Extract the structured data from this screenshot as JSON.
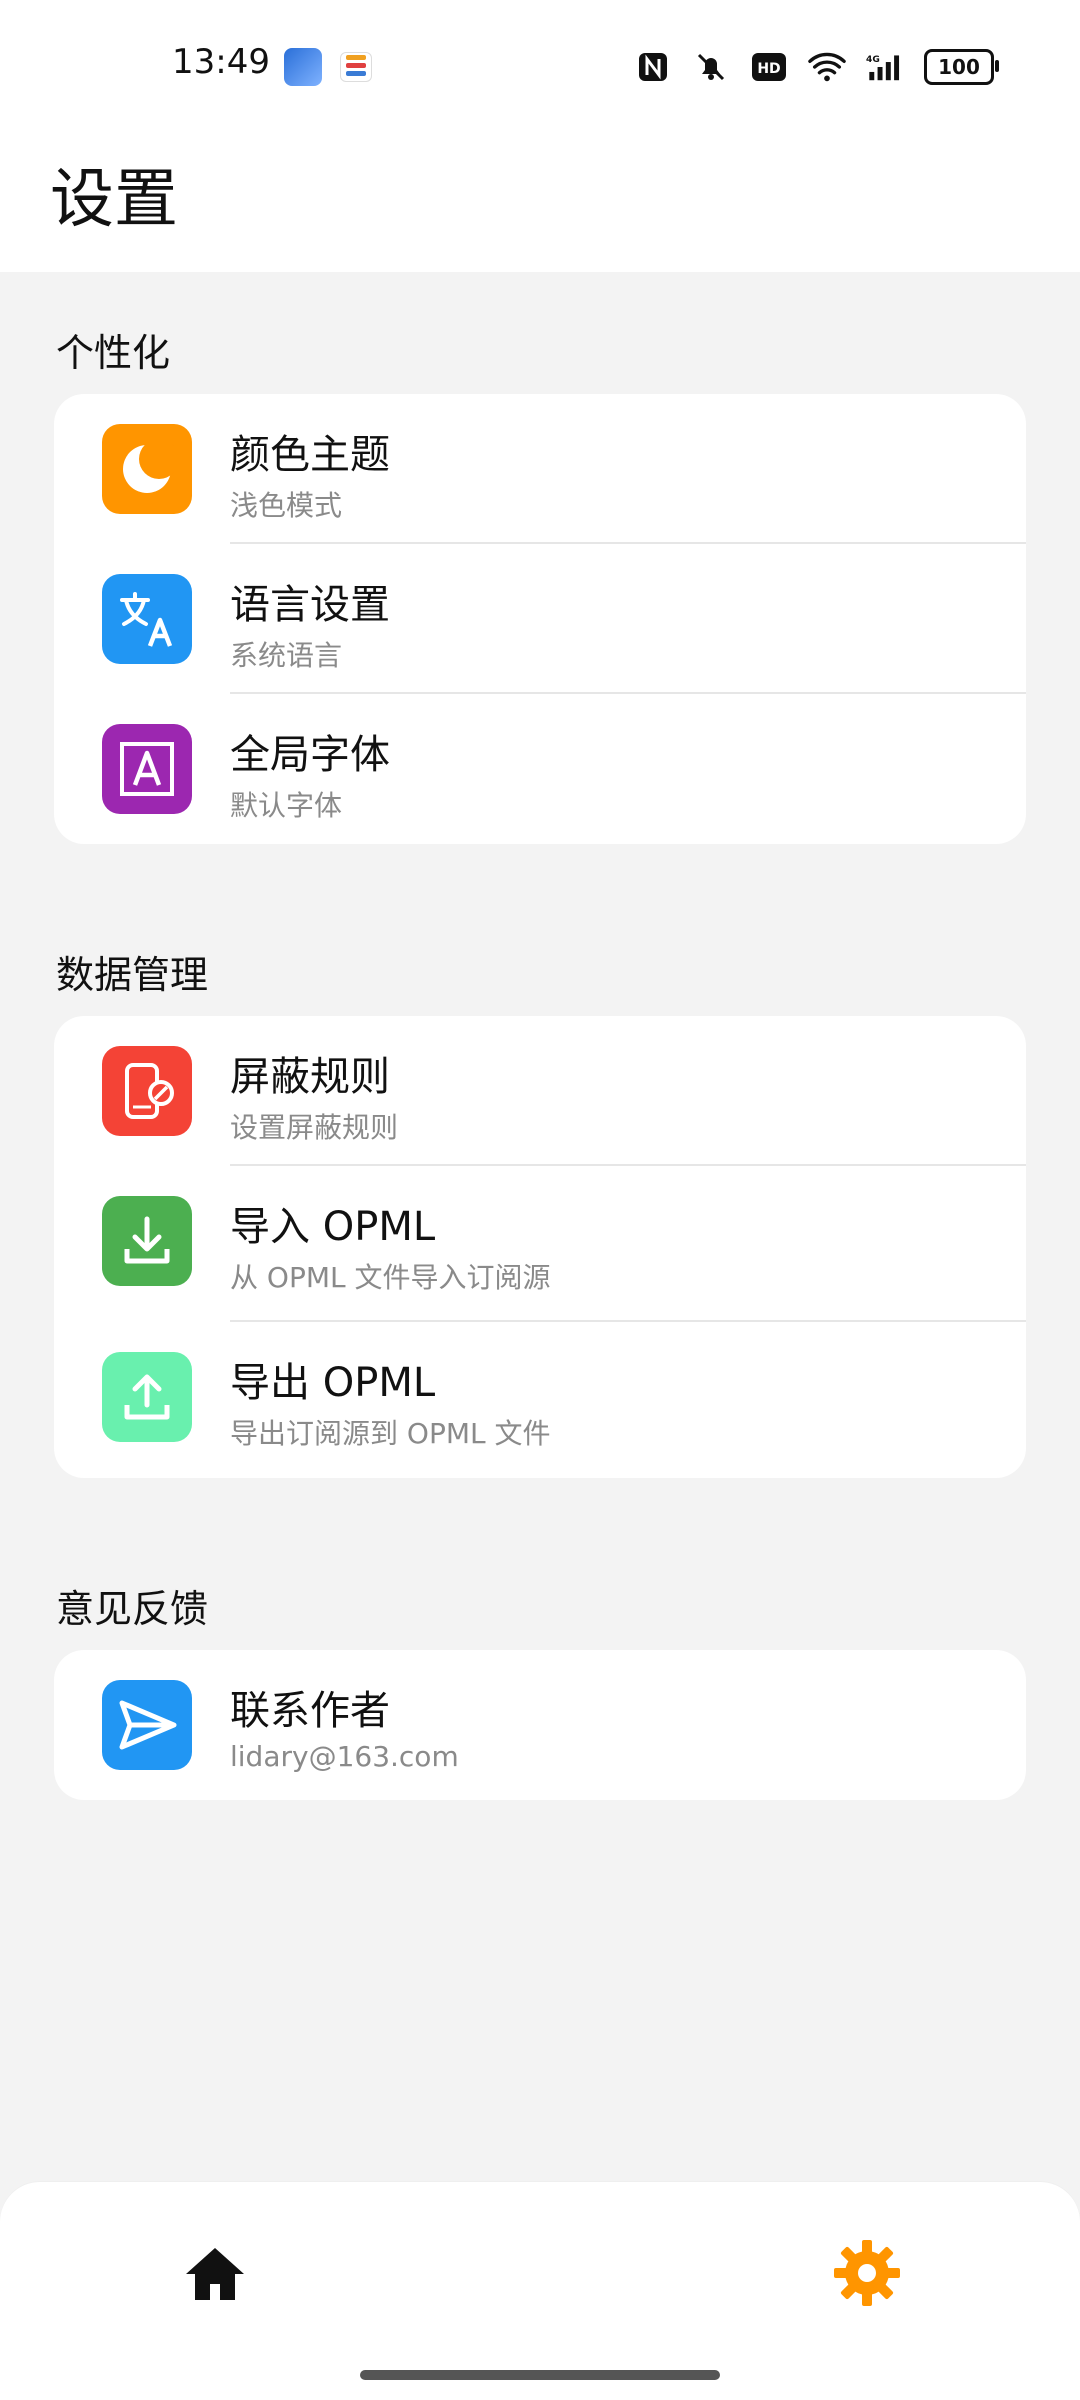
{
  "status_bar": {
    "time": "13:49",
    "battery": "100",
    "icons": [
      "nfc-icon",
      "mute-icon",
      "hd-icon",
      "wifi-icon",
      "signal-4g-icon",
      "battery-icon"
    ]
  },
  "header": {
    "title": "设置"
  },
  "sections": [
    {
      "title": "个性化",
      "items": [
        {
          "title": "颜色主题",
          "subtitle": "浅色模式",
          "icon": "moon-icon",
          "color": "#FF9500"
        },
        {
          "title": "语言设置",
          "subtitle": "系统语言",
          "icon": "translate-icon",
          "color": "#2196F3"
        },
        {
          "title": "全局字体",
          "subtitle": "默认字体",
          "icon": "font-icon",
          "color": "#9C27B0"
        }
      ]
    },
    {
      "title": "数据管理",
      "items": [
        {
          "title": "屏蔽规则",
          "subtitle": "设置屏蔽规则",
          "icon": "block-phone-icon",
          "color": "#F44336"
        },
        {
          "title": "导入 OPML",
          "subtitle": "从 OPML 文件导入订阅源",
          "icon": "import-icon",
          "color": "#4CAF50"
        },
        {
          "title": "导出 OPML",
          "subtitle": "导出订阅源到 OPML 文件",
          "icon": "export-icon",
          "color": "#69F0AE"
        }
      ]
    },
    {
      "title": "意见反馈",
      "items": [
        {
          "title": "联系作者",
          "subtitle": "lidary@163.com",
          "icon": "send-icon",
          "color": "#2196F3"
        }
      ]
    }
  ],
  "bottom_nav": {
    "items": [
      {
        "icon": "home-icon",
        "active": false
      },
      {
        "icon": "gear-icon",
        "active": true,
        "color": "#FF9500"
      }
    ]
  }
}
